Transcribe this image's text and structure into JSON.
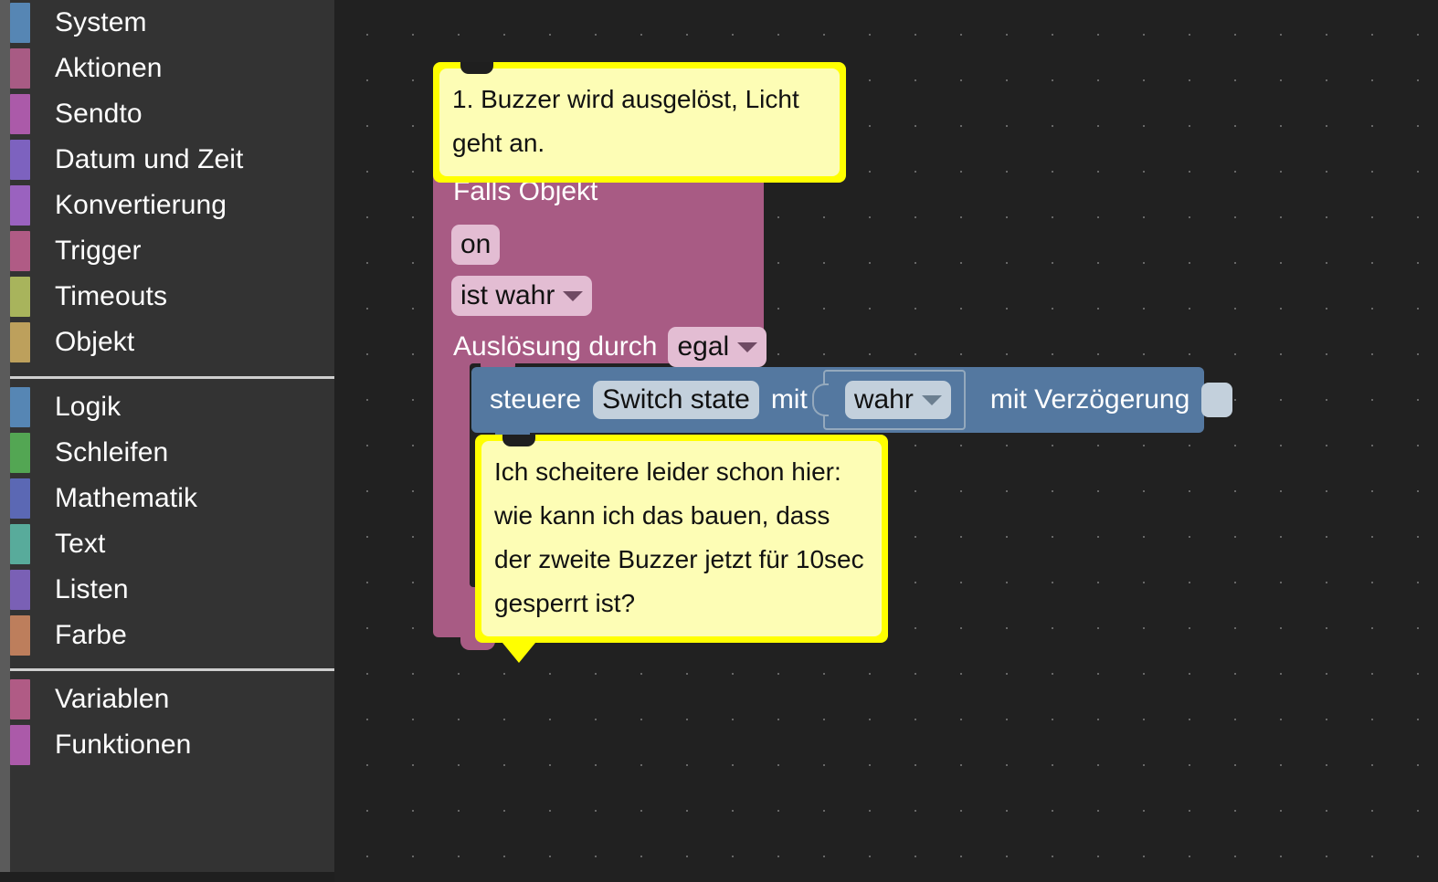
{
  "sidebar": {
    "groups": [
      {
        "name": "core-categories",
        "items": [
          {
            "label": "System",
            "color": "#5686b4"
          },
          {
            "label": "Aktionen",
            "color": "#a85b84"
          },
          {
            "label": "Sendto",
            "color": "#ab5aa9"
          },
          {
            "label": "Datum und Zeit",
            "color": "#7d62bf"
          },
          {
            "label": "Konvertierung",
            "color": "#9a62bf"
          },
          {
            "label": "Trigger",
            "color": "#b05b85"
          },
          {
            "label": "Timeouts",
            "color": "#a8b койка"
          },
          {
            "label": "Objekt",
            "color": "#bda05c"
          }
        ]
      },
      {
        "name": "language-categories",
        "items": [
          {
            "label": "Logik",
            "color": "#5686b4"
          },
          {
            "label": "Schleifen",
            "color": "#53a653"
          },
          {
            "label": "Mathematik",
            "color": "#5b68b4"
          },
          {
            "label": "Text",
            "color": "#58ab9b"
          },
          {
            "label": "Listen",
            "color": "#7a60b5"
          },
          {
            "label": "Farbe",
            "color": "#bd7e5c"
          }
        ]
      },
      {
        "name": "user-categories",
        "items": [
          {
            "label": "Variablen",
            "color": "#b05b85"
          },
          {
            "label": "Funktionen",
            "color": "#ab5aa9"
          }
        ]
      }
    ]
  },
  "workspace": {
    "comments": [
      {
        "id": "comment-top",
        "text": "1. Buzzer wird ausgelöst, Licht geht an.",
        "border_color": "#ffff00",
        "fill_color": "#fdfdb5"
      },
      {
        "id": "comment-inline",
        "text": "Ich scheitere leider schon hier: wie kann ich das bauen, dass der zweite Buzzer jetzt für 10sec gesperrt ist?",
        "border_color": "#ffff00",
        "fill_color": "#fdfdb5"
      }
    ],
    "if_object_block": {
      "color": "#a85b84",
      "title": "Falls Objekt",
      "object_id_field": "on",
      "condition_field": "ist wahr",
      "trigger_label": "Auslösung durch",
      "trigger_field": "egal"
    },
    "control_block": {
      "color": "#5478a0",
      "verb": "steuere",
      "target_field": "Switch state",
      "with_label": "mit",
      "value_field": "wahr",
      "delay_label": "mit Verzögerung",
      "delay_checkbox": ""
    }
  }
}
